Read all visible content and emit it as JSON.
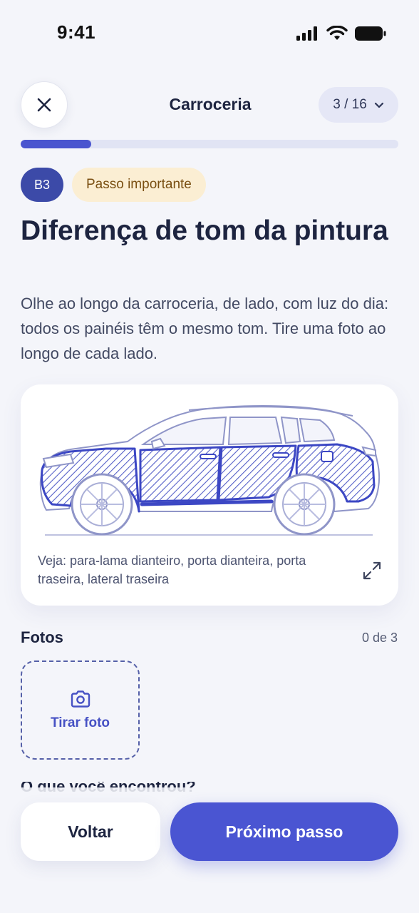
{
  "status_bar": {
    "time": "9:41"
  },
  "header": {
    "title": "Carroceria",
    "step_indicator": "3 / 16"
  },
  "progress": {
    "current": 3,
    "total": 16
  },
  "step": {
    "code": "B3",
    "badge": "Passo importante",
    "title": "Diferença de tom da pintura",
    "description": "Olhe ao longo da carroceria, de lado, com luz do dia: todos os painéis têm o mesmo tom. Tire uma foto ao longo de cada lado."
  },
  "illustration": {
    "caption": "Veja: para-lama dianteiro, porta dianteira, porta traseira, lateral traseira"
  },
  "photos": {
    "title": "Fotos",
    "count": "0 de 3",
    "take_photo_label": "Tirar foto"
  },
  "next_section_peek": "O que você encontrou?",
  "footer": {
    "back_label": "Voltar",
    "next_label": "Próximo passo"
  },
  "colors": {
    "accent": "#4a55d2",
    "badge_bg": "#fbeed3",
    "code_badge": "#3c4aa8"
  }
}
